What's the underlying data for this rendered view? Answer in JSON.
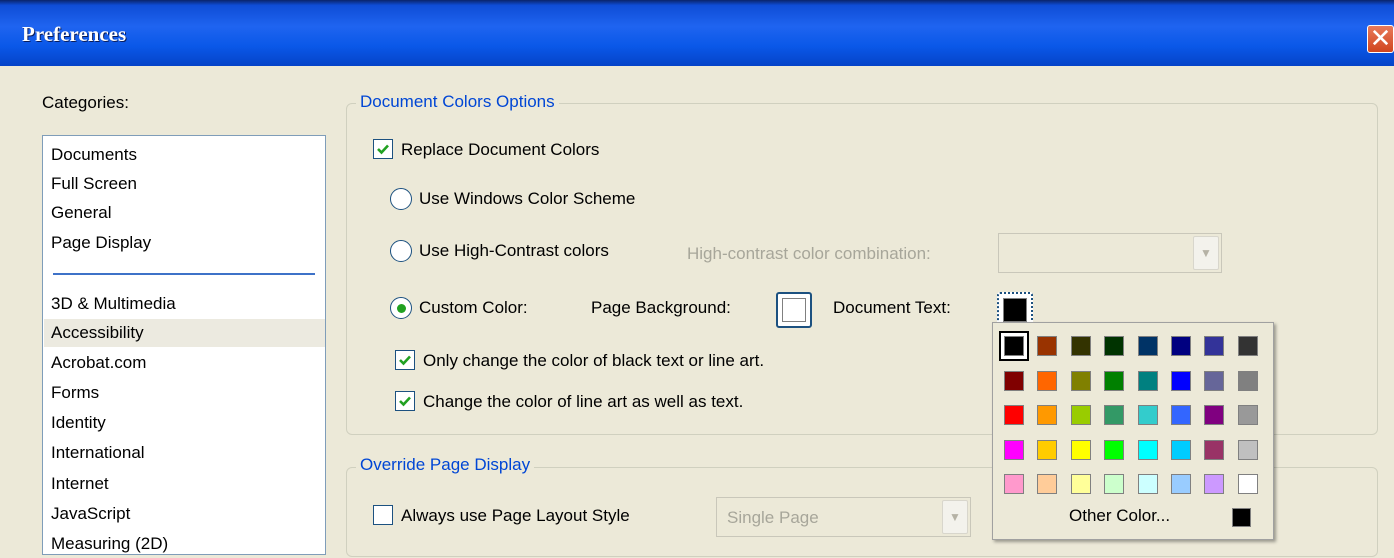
{
  "window": {
    "title": "Preferences",
    "close_glyph": "✕"
  },
  "categories": {
    "label": "Categories:",
    "group1": [
      "Documents",
      "Full Screen",
      "General",
      "Page Display"
    ],
    "group2": [
      "3D & Multimedia",
      "Accessibility",
      "Acrobat.com",
      "Forms",
      "Identity",
      "International",
      "Internet",
      "JavaScript",
      "Measuring (2D)"
    ],
    "selected": "Accessibility"
  },
  "document_colors": {
    "title": "Document Colors Options",
    "replace_label": "Replace Document Colors",
    "replace_checked": true,
    "use_windows_label": "Use Windows Color Scheme",
    "use_high_contrast_label": "Use High-Contrast colors",
    "high_contrast_combo_label": "High-contrast color combination:",
    "custom_color_label": "Custom Color:",
    "custom_color_selected": true,
    "page_background_label": "Page Background:",
    "page_background_color": "#FFFFFF",
    "document_text_label": "Document Text:",
    "document_text_color": "#000000",
    "only_black_label": "Only change the color of black text or line art.",
    "only_black_checked": true,
    "line_art_label": "Change the color of line art as well as text.",
    "line_art_checked": true
  },
  "override_page_display": {
    "title": "Override Page Display",
    "always_layout_label": "Always use Page Layout Style",
    "always_layout_checked": false,
    "layout_value": "Single Page"
  },
  "palette": {
    "colors": [
      [
        "#000000",
        "#993300",
        "#333300",
        "#003300",
        "#003366",
        "#000080",
        "#333399",
        "#333333"
      ],
      [
        "#800000",
        "#FF6600",
        "#808000",
        "#008000",
        "#008080",
        "#0000FF",
        "#666699",
        "#808080"
      ],
      [
        "#FF0000",
        "#FF9900",
        "#99CC00",
        "#339966",
        "#33CCCC",
        "#3366FF",
        "#800080",
        "#999999"
      ],
      [
        "#FF00FF",
        "#FFCC00",
        "#FFFF00",
        "#00FF00",
        "#00FFFF",
        "#00CCFF",
        "#993366",
        "#C0C0C0"
      ],
      [
        "#FF99CC",
        "#FFCC99",
        "#FFFF99",
        "#CCFFCC",
        "#CCFFFF",
        "#99CCFF",
        "#CC99FF",
        "#FFFFFF"
      ]
    ],
    "selected_color": "#000000",
    "other_color_label": "Other Color...",
    "other_color_swatch": "#000000"
  },
  "icons": {
    "check": "check-icon",
    "dropdown": "chevron-down-icon",
    "close": "close-icon"
  }
}
